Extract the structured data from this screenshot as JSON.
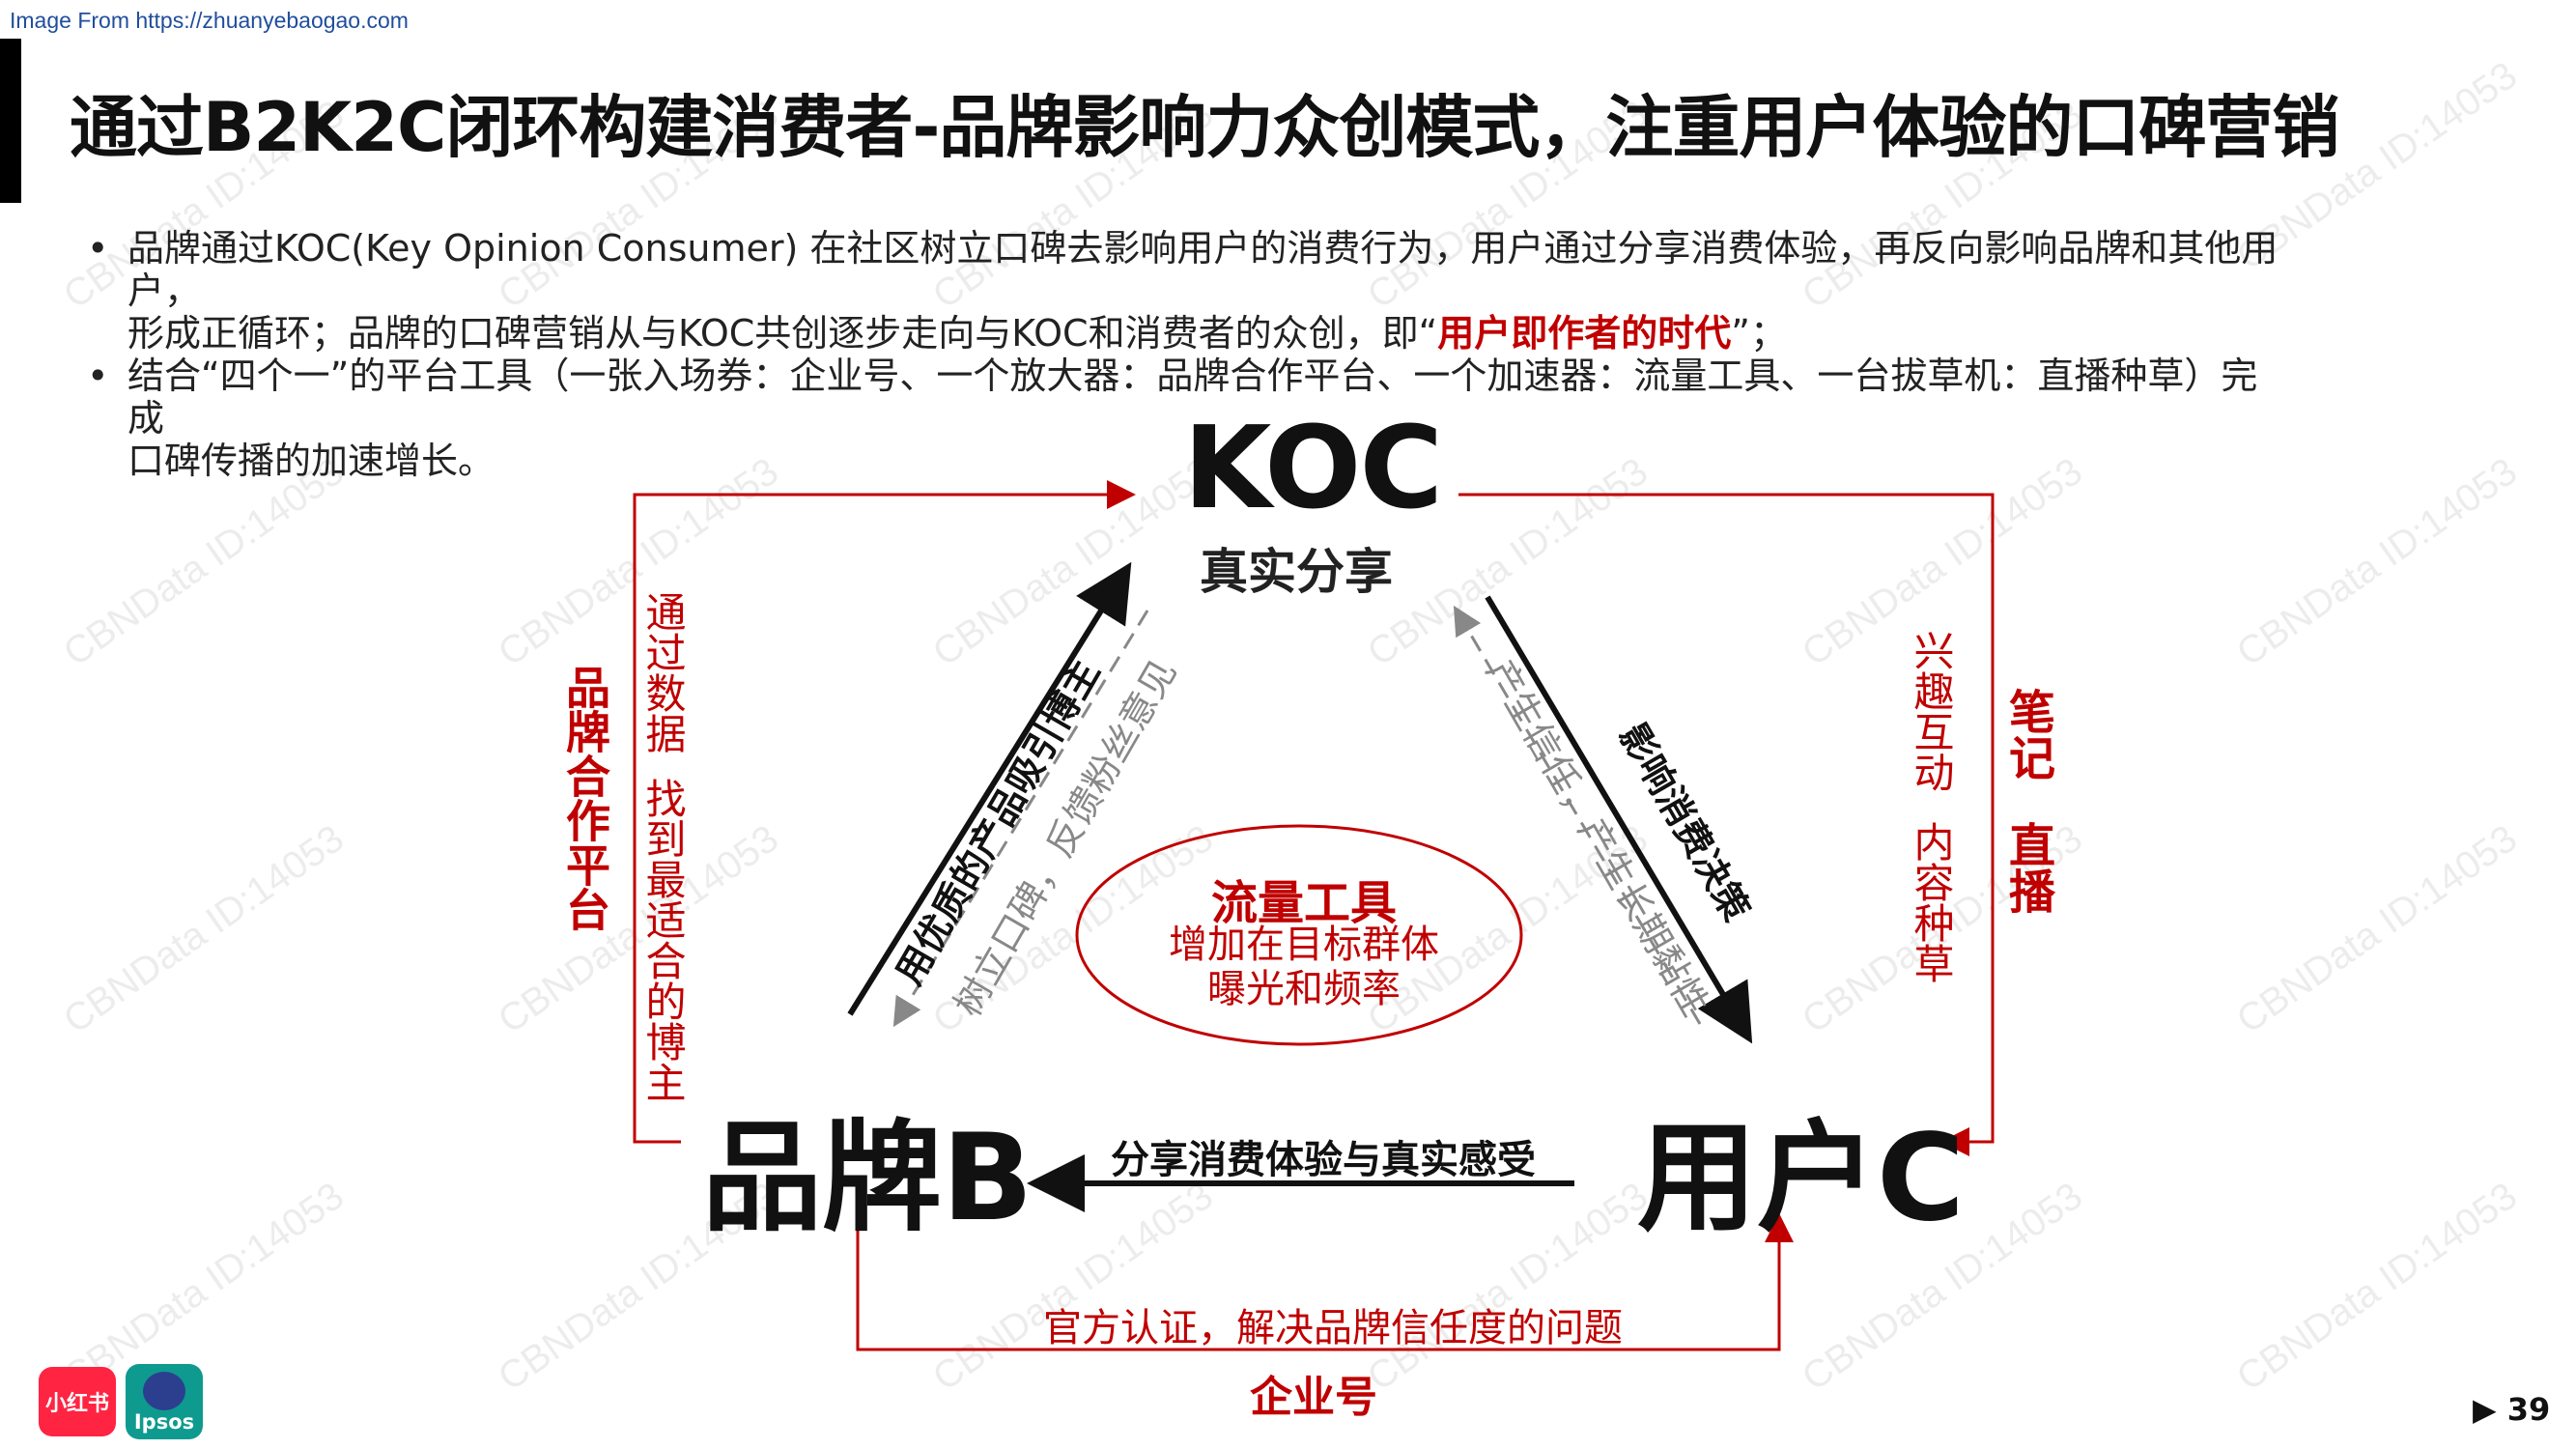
{
  "source_note": "Image From https://zhuanyebaogao.com",
  "title": "通过B2K2C闭环构建消费者-品牌影响力众创模式，注重用户体验的口碑营销",
  "bullets": {
    "dot": "•",
    "b1_text_a": "品牌通过KOC(Key Opinion Consumer) 在社区树立口碑去影响用户的消费行为，用户通过分享消费体验，再反向影响品牌和其他用户，",
    "b1_text_b": "形成正循环；品牌的口碑营销从与KOC共创逐步走向与KOC和消费者的众创，即“",
    "b1_highlight": "用户即作者的时代",
    "b1_text_c": "”；",
    "b2_text_a": "结合“四个一”的平台工具（一张入场券：企业号、一个放大器：品牌合作平台、一个加速器：流量工具、一台拔草机：直播种草）完成",
    "b2_text_b": "口碑传播的加速增长。"
  },
  "diagram": {
    "koc": "KOC",
    "koc_sub": "真实分享",
    "brand": "品牌B",
    "user": "用户C",
    "left_platform": "品牌合作平台",
    "left_desc_1": "通过数据",
    "left_desc_2": "找到最适合的博主",
    "right_desc_1": "兴趣互动",
    "right_desc_2": "内容种草",
    "right_label_1": "笔记",
    "right_label_2": "直播",
    "edge_brand_koc": "用优质的产品吸引博主",
    "edge_koc_brand": "树立口碑，反馈粉丝意见",
    "edge_koc_user": "影响消费决策",
    "edge_user_koc": "产生信任，产生长期黏性",
    "flow_title": "流量工具",
    "flow_desc_1": "增加在目标群体",
    "flow_desc_2": "曝光和频率",
    "edge_user_brand": "分享消费体验与真实感受",
    "bottom_desc": "官方认证，解决品牌信任度的问题",
    "bottom_label": "企业号"
  },
  "watermark": "CBNData ID:14053",
  "logos": {
    "xhs": "小红书",
    "ipsos": "Ipsos"
  },
  "page_number": "▶ 39",
  "colors": {
    "accent_red": "#c00000",
    "text_dark": "#111111",
    "gray_dashed": "#888888",
    "link_blue": "#1f4e9c"
  }
}
